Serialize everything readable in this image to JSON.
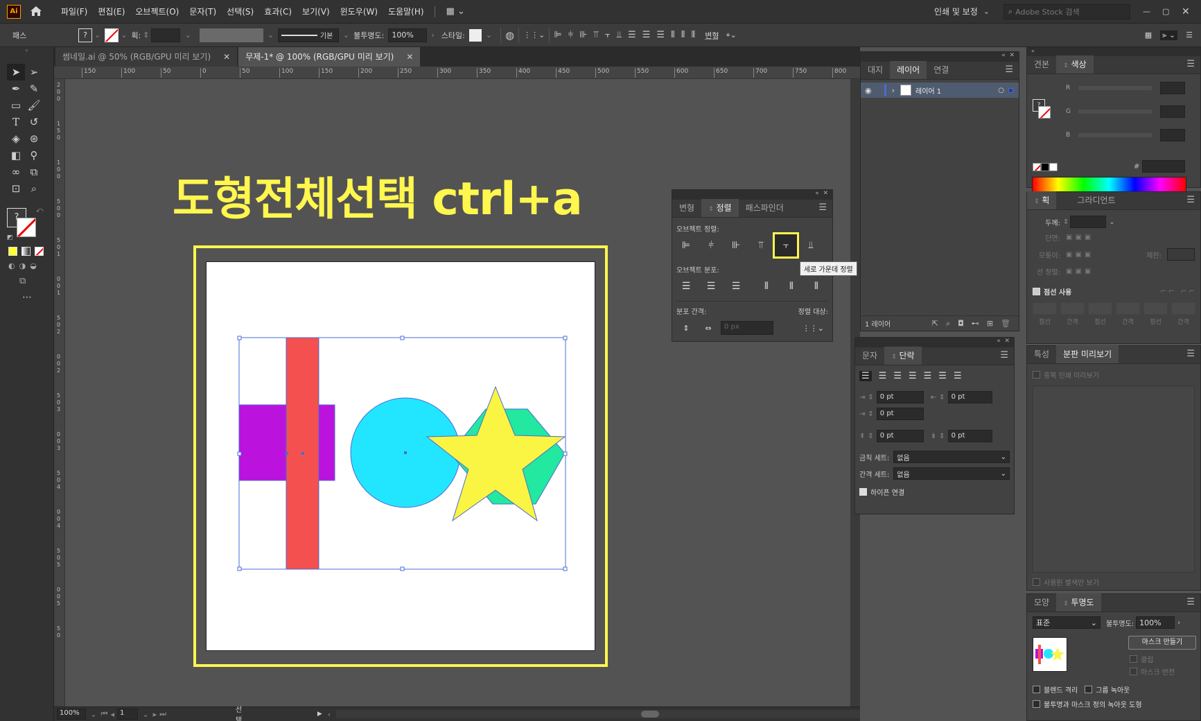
{
  "app": {
    "logo": "Ai"
  },
  "menu": {
    "items": [
      "파일(F)",
      "편집(E)",
      "오브젝트(O)",
      "문자(T)",
      "선택(S)",
      "효과(C)",
      "보기(V)",
      "윈도우(W)",
      "도움말(H)"
    ],
    "workspace": "인쇄 및 보정",
    "stock_placeholder": "Adobe Stock 검색"
  },
  "control": {
    "selection_label": "패스",
    "stroke_label": "획:",
    "stroke_style": "기본",
    "opacity_label": "불투명도:",
    "opacity_value": "100%",
    "style_label": "스타일:",
    "transform_label": "변형"
  },
  "tabs": [
    {
      "label": "썸네일.ai @ 50% (RGB/GPU 미리 보기)"
    },
    {
      "label": "무제-1* @ 100% (RGB/GPU 미리 보기)"
    }
  ],
  "ruler": {
    "h_labels": [
      "150",
      "100",
      "50",
      "0",
      "50",
      "100",
      "150",
      "200",
      "250",
      "300",
      "350",
      "400",
      "450",
      "500",
      "550",
      "600",
      "650",
      "700",
      "750",
      "800"
    ],
    "v_labels": [
      "2",
      "0",
      "0",
      "1",
      "5",
      "0",
      "1",
      "0",
      "0",
      "5",
      "0",
      "0",
      "5",
      "0",
      "1",
      "0",
      "0",
      "1",
      "5",
      "0",
      "2",
      "0",
      "0",
      "2",
      "5",
      "0",
      "3",
      "0",
      "0",
      "3",
      "5",
      "0",
      "4",
      "0",
      "0",
      "4",
      "5",
      "0",
      "5",
      "0",
      "0",
      "5",
      "5",
      "0"
    ]
  },
  "canvas": {
    "headline": "도형전체선택 ctrl+a",
    "colors": {
      "highlight": "#fff64e",
      "red": "#f45050",
      "purple": "#bb12de",
      "cyan": "#22e6ff",
      "green": "#22e8a0",
      "star": "#faf443",
      "selection": "#4a6cd4"
    }
  },
  "layers_panel": {
    "tabs": [
      "대지",
      "레이어",
      "연결"
    ],
    "layer_name": "레이어 1",
    "footer_count": "1 레이어"
  },
  "align_panel": {
    "tabs": [
      "변형",
      "정렬",
      "패스파인더"
    ],
    "section_align": "오브젝트 정렬:",
    "section_distribute": "오브젝트 분포:",
    "section_spacing": "분포 간격:",
    "align_to": "정렬 대상:",
    "spacing_value": "0 px",
    "tooltip": "세로 가운데 정렬"
  },
  "color_panel": {
    "tabs": [
      "견본",
      "색상"
    ],
    "channels": [
      "R",
      "G",
      "B"
    ],
    "hash": "#"
  },
  "stroke_panel": {
    "tabs": [
      "획",
      "그라디언트"
    ],
    "weight_label": "두께:",
    "cap_label": "단면:",
    "corner_label": "모퉁이:",
    "limit_label": "제한:",
    "align_label": "선 정렬:",
    "dash_label": "점선 사용",
    "dash_cols": [
      "점선",
      "간격",
      "점선",
      "간격",
      "점선",
      "간격"
    ]
  },
  "paragraph_panel": {
    "tabs": [
      "문자",
      "단락"
    ],
    "pt_values": [
      "0 pt",
      "0 pt",
      "0 pt",
      "0 pt",
      "0 pt"
    ],
    "kinsoku_label": "금칙 세트:",
    "kinsoku_value": "없음",
    "mojikumi_label": "간격 세트:",
    "mojikumi_value": "없음",
    "hyphen_label": "하이픈 연결"
  },
  "attributes_panel": {
    "tabs": [
      "특성",
      "분판 미리보기"
    ],
    "overprint_label": "중복 인쇄 미리보기",
    "used_spot_label": "사용된 별색만 보기"
  },
  "transparency_panel": {
    "tabs": [
      "모양",
      "투명도"
    ],
    "blend_mode": "표준",
    "opacity_label": "불투명도:",
    "opacity_value": "100%",
    "mask_button": "마스크 만들기",
    "clip_label": "클립",
    "invert_label": "마스크 반전",
    "isolate_label": "블렌드 격리",
    "knockout_label": "그룹 녹아웃",
    "opacity_mask_label": "불투명과 마스크 정의 녹아웃 도형"
  },
  "status": {
    "zoom": "100%",
    "page": "1",
    "tool": "선택"
  }
}
